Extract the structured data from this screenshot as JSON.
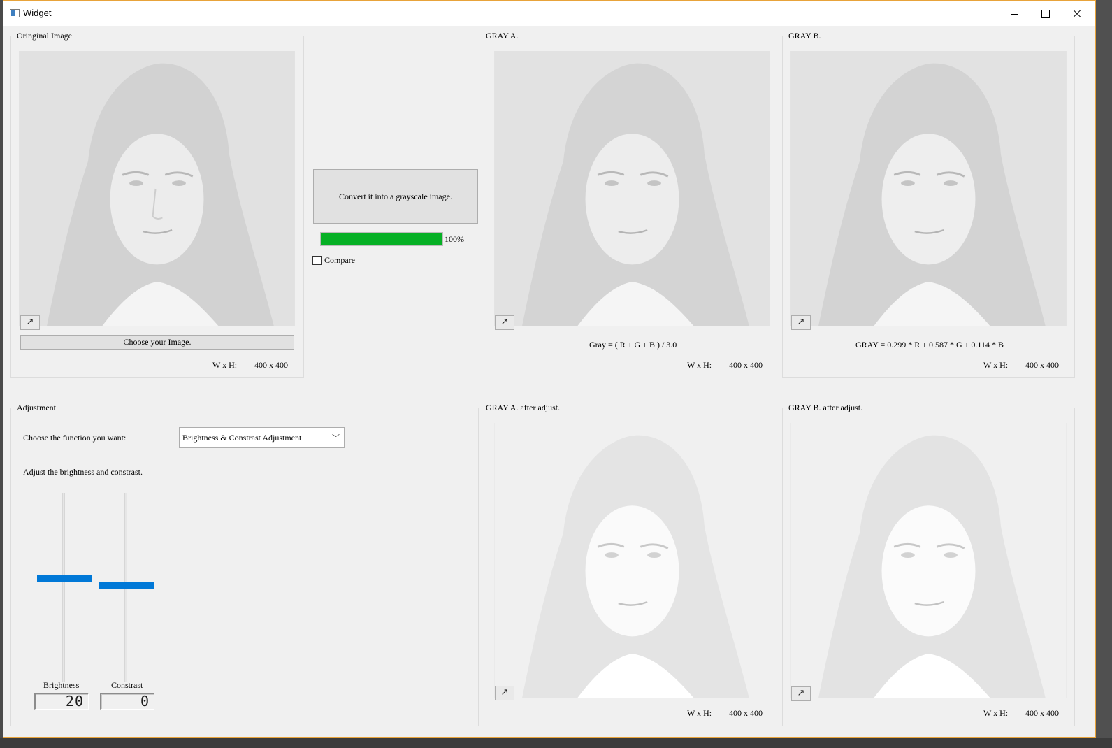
{
  "window": {
    "title": "Widget"
  },
  "original": {
    "group_title": "Oringinal Image",
    "choose_button": "Choose your Image.",
    "wh_label": "W x H:",
    "wh_value": "400 x 400"
  },
  "convert": {
    "button_label": "Convert it into a grayscale image.",
    "progress_percent": 100,
    "progress_text": "100%",
    "compare_label": "Compare",
    "compare_checked": false
  },
  "gray_a": {
    "group_title": "GRAY A.",
    "formula": "Gray = ( R + G + B ) / 3.0",
    "wh_label": "W x H:",
    "wh_value": "400 x 400"
  },
  "gray_b": {
    "group_title": "GRAY B.",
    "formula": "GRAY = 0.299 * R + 0.587 * G + 0.114 * B",
    "wh_label": "W x H:",
    "wh_value": "400 x 400"
  },
  "adjustment": {
    "group_title": "Adjustment",
    "choose_label": "Choose the function you want:",
    "function_selected": "Brightness & Constrast Adjustment",
    "instruction": "Adjust the brightness and constrast.",
    "brightness_label": "Brightness",
    "brightness_value": "20",
    "contrast_label": "Constrast",
    "contrast_value": "0"
  },
  "gray_a_adjusted": {
    "group_title": "GRAY A. after adjust.",
    "wh_label": "W x H:",
    "wh_value": "400 x 400"
  },
  "gray_b_adjusted": {
    "group_title": "GRAY B. after adjust.",
    "wh_label": "W x H:",
    "wh_value": "400 x 400"
  },
  "icons": {
    "expand": "expand-arrow-icon",
    "combo_arrow": "chevron-down-icon"
  },
  "colors": {
    "progress": "#06b025",
    "slider_handle": "#0078d7",
    "window_bg": "#f0f0f0"
  }
}
